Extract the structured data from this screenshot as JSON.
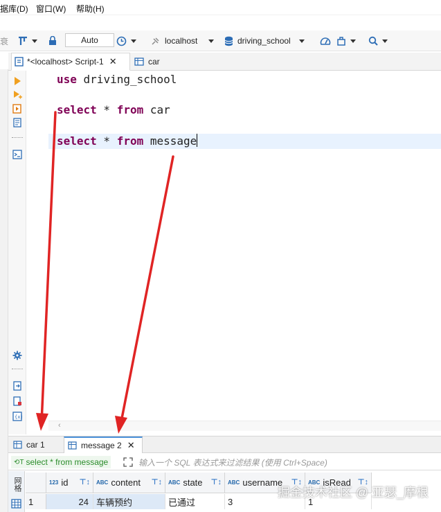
{
  "menu": {
    "items": [
      "据库(D)",
      "窗口(W)",
      "帮助(H)"
    ]
  },
  "toolbar": {
    "left_char": "衰",
    "commit_mode": "Auto",
    "connection": "localhost",
    "database": "driving_school"
  },
  "editor_tabs": [
    {
      "label": "*<localhost> Script-1",
      "close": "✕"
    },
    {
      "label": "car"
    }
  ],
  "editor": {
    "lines": [
      {
        "kw1": "use",
        "rest": " driving_school"
      },
      {
        "kw1": "select",
        "mid": " * ",
        "kw2": "from",
        "rest": " car"
      },
      {
        "kw1": "select",
        "mid": " * ",
        "kw2": "from",
        "rest": " message"
      }
    ]
  },
  "result_tabs": [
    {
      "label": "car 1"
    },
    {
      "label": "message 2",
      "close": "✕"
    }
  ],
  "filter": {
    "query": "select * from message",
    "placeholder": "输入一个 SQL 表达式来过滤结果 (使用 Ctrl+Space)"
  },
  "grid": {
    "side_label": "网格",
    "columns": [
      {
        "type": "123",
        "name": "id"
      },
      {
        "type": "ABC",
        "name": "content"
      },
      {
        "type": "ABC",
        "name": "state"
      },
      {
        "type": "ABC",
        "name": "username"
      },
      {
        "type": "ABC",
        "name": "isRead"
      }
    ],
    "rows": [
      {
        "num": "1",
        "cells": [
          "24",
          "车辆预约",
          "已通过",
          "3",
          "1"
        ]
      }
    ]
  },
  "watermark": "掘金技术社区 @ 亚瑟_摩根",
  "colors": {
    "keyword": "#7f0055",
    "arrow": "#e02424",
    "current_line": "#e8f2fe",
    "filter_text": "#2a8c2a"
  }
}
